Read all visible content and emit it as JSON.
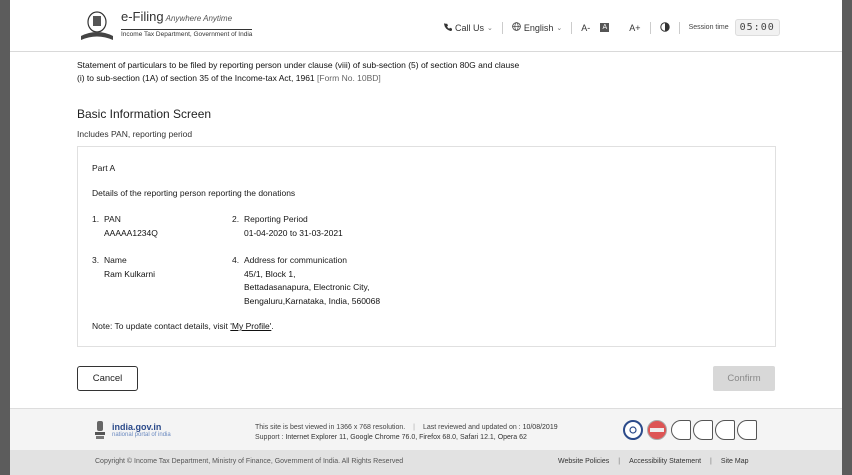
{
  "header": {
    "logo_title": "e-Filing",
    "logo_tagline": "Anywhere Anytime",
    "logo_subtitle": "Income Tax Department, Government of India",
    "call_us": "Call Us",
    "language": "English",
    "font_decrease": "A-",
    "font_reset": "A",
    "font_increase": "A+",
    "session_label": "Session time",
    "session_time": "05:00"
  },
  "page": {
    "form_title_line1": "Statement of particulars to be filed by reporting person under clause (viii) of sub-section (5) of section 80G and clause",
    "form_title_line2": "(i) to sub-section (1A) of section 35 of the Income-tax Act, 1961",
    "form_number": "[Form No. 10BD]",
    "screen_title": "Basic Information Screen",
    "screen_subtitle": "Includes PAN, reporting period"
  },
  "card": {
    "part": "Part A",
    "description": "Details of the reporting person reporting the donations",
    "fields": [
      {
        "num": "1.",
        "label": "PAN",
        "value": "AAAAA1234Q"
      },
      {
        "num": "2.",
        "label": "Reporting Period",
        "value": "01-04-2020 to 31-03-2021"
      },
      {
        "num": "3.",
        "label": "Name",
        "value": "Ram Kulkarni"
      },
      {
        "num": "4.",
        "label": "Address for communication",
        "lines": [
          "45/1, Block 1,",
          "Bettadasanapura, Electronic City,",
          "Bengaluru,Karnataka, India, 560068"
        ]
      }
    ],
    "note_prefix": "Note: To update contact details, visit",
    "note_link": "'My Profile'",
    "note_suffix": "."
  },
  "buttons": {
    "cancel": "Cancel",
    "confirm": "Confirm"
  },
  "footer": {
    "gov_main": "india.gov.in",
    "gov_sub": "national portal of india",
    "best_viewed": "This site is best viewed in 1366 x 768 resolution.",
    "last_reviewed_label": "Last reviewed and updated on :",
    "last_reviewed_date": "10/08/2019",
    "support_label": "Support :",
    "support_browsers": "Internet Explorer 11, Google Chrome 76.0,  Firefox 68.0, Safari 12.1, Opera 62",
    "copyright": "Copyright © Income Tax Department, Ministry of Finance, Government of India. All Rights Reserved",
    "links": [
      "Website Policies",
      "Accessibility Statement",
      "Site Map"
    ],
    "divider": "|"
  }
}
